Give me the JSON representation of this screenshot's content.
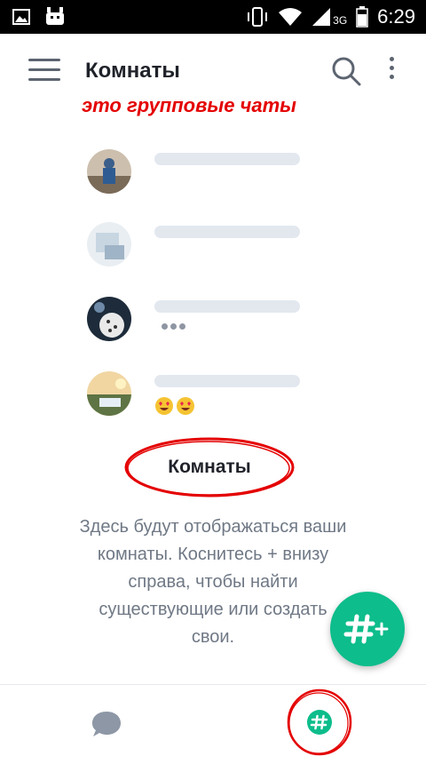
{
  "status_bar": {
    "time": "6:29",
    "network": "3G",
    "icons": [
      "image-icon",
      "android-icon",
      "vibrate-icon",
      "wifi-icon",
      "signal-icon",
      "battery-icon"
    ]
  },
  "app_bar": {
    "title": "Комнаты",
    "icons": [
      "menu-icon",
      "search-icon",
      "more-vert-icon"
    ]
  },
  "annotation_top": "это групповые чаты",
  "rooms_placeholder": {
    "items": [
      {
        "avatar": "photo-person",
        "preview": ""
      },
      {
        "avatar": "photo-device",
        "preview": ""
      },
      {
        "avatar": "photo-ball",
        "preview": "typing-dots"
      },
      {
        "avatar": "photo-landscape",
        "preview": "😍😍"
      }
    ]
  },
  "empty_state": {
    "title": "Комнаты",
    "description_lines": [
      "Здесь будут отображаться ваши",
      "комнаты. Коснитесь + внизу",
      "справа, чтобы найти",
      "существующие или создать",
      "свои."
    ]
  },
  "fab": {
    "icon": "hash-plus-icon"
  },
  "bottom_nav": {
    "tabs": [
      {
        "icon": "chat-bubble-icon"
      },
      {
        "icon": "hash-icon",
        "active": true
      }
    ]
  },
  "colors": {
    "accent": "#0dbd8b",
    "annotation": "#e40000",
    "placeholder_bar": "#e3e8ef",
    "text_primary": "#1f2229",
    "text_secondary": "#6f7885"
  }
}
